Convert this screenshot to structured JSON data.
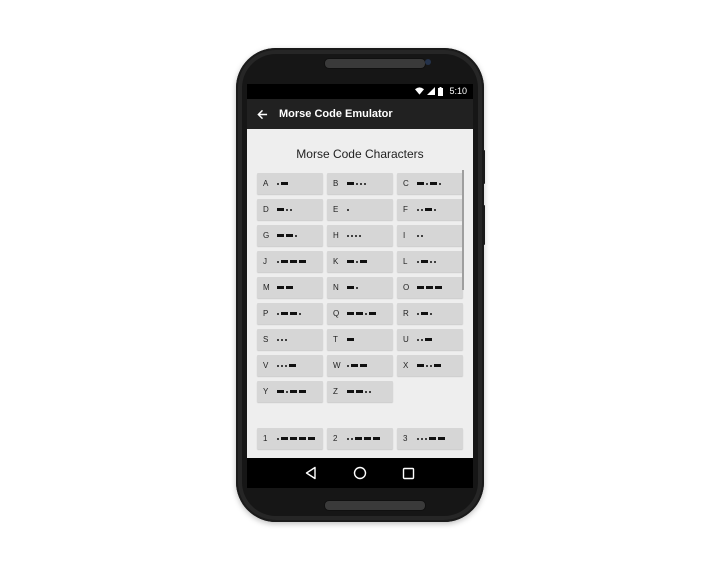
{
  "status_bar": {
    "time": "5:10"
  },
  "app_bar": {
    "title": "Morse Code Emulator",
    "back_icon": "arrow-back-icon"
  },
  "heading": "Morse Code Characters",
  "letters": [
    {
      "char": "A",
      "code": ".-"
    },
    {
      "char": "B",
      "code": "-..."
    },
    {
      "char": "C",
      "code": "-.-."
    },
    {
      "char": "D",
      "code": "-.."
    },
    {
      "char": "E",
      "code": "."
    },
    {
      "char": "F",
      "code": "..-."
    },
    {
      "char": "G",
      "code": "--."
    },
    {
      "char": "H",
      "code": "...."
    },
    {
      "char": "I",
      "code": ".."
    },
    {
      "char": "J",
      "code": ".---"
    },
    {
      "char": "K",
      "code": "-.-"
    },
    {
      "char": "L",
      "code": ".-.."
    },
    {
      "char": "M",
      "code": "--"
    },
    {
      "char": "N",
      "code": "-."
    },
    {
      "char": "O",
      "code": "---"
    },
    {
      "char": "P",
      "code": ".--."
    },
    {
      "char": "Q",
      "code": "--.-"
    },
    {
      "char": "R",
      "code": ".-."
    },
    {
      "char": "S",
      "code": "..."
    },
    {
      "char": "T",
      "code": "-"
    },
    {
      "char": "U",
      "code": "..-"
    },
    {
      "char": "V",
      "code": "...-"
    },
    {
      "char": "W",
      "code": ".--"
    },
    {
      "char": "X",
      "code": "-..-"
    },
    {
      "char": "Y",
      "code": "-.--"
    },
    {
      "char": "Z",
      "code": "--.."
    }
  ],
  "numbers": [
    {
      "char": "1",
      "code": ".----"
    },
    {
      "char": "2",
      "code": "..---"
    },
    {
      "char": "3",
      "code": "...--"
    }
  ],
  "nav_bar": {
    "back_icon": "triangle-back-icon",
    "home_icon": "circle-home-icon",
    "recents_icon": "square-recents-icon"
  }
}
